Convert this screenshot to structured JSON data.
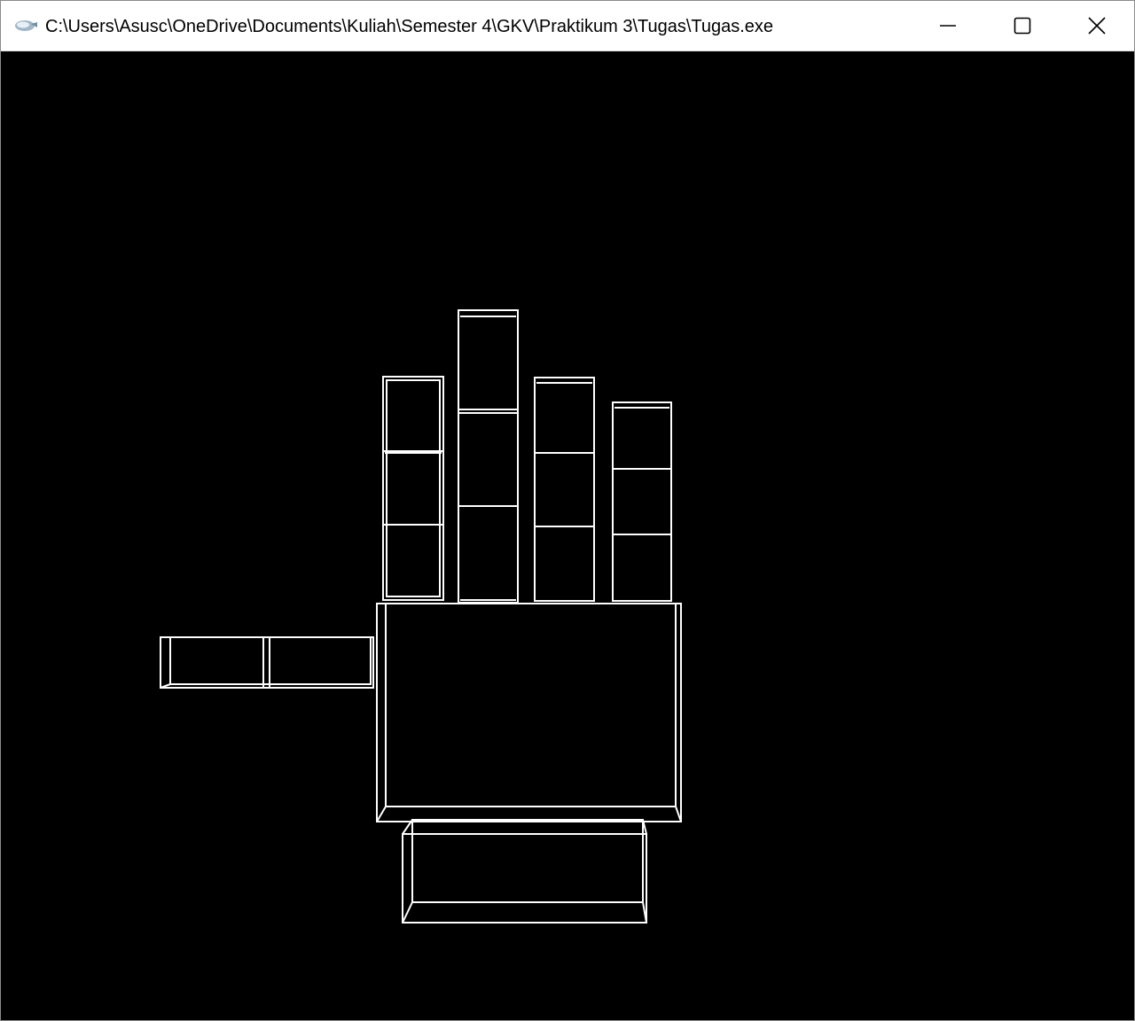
{
  "window": {
    "title": "C:\\Users\\Asusc\\OneDrive\\Documents\\Kuliah\\Semester 4\\GKV\\Praktikum 3\\Tugas\\Tugas.exe",
    "app_icon": "opengl-app-icon",
    "controls": {
      "minimize_icon": "minimize-icon",
      "maximize_icon": "maximize-icon",
      "close_icon": "close-icon"
    }
  },
  "canvas": {
    "background": "#000000",
    "wire_color": "#ffffff",
    "scene": "wireframe-robot-hand"
  }
}
